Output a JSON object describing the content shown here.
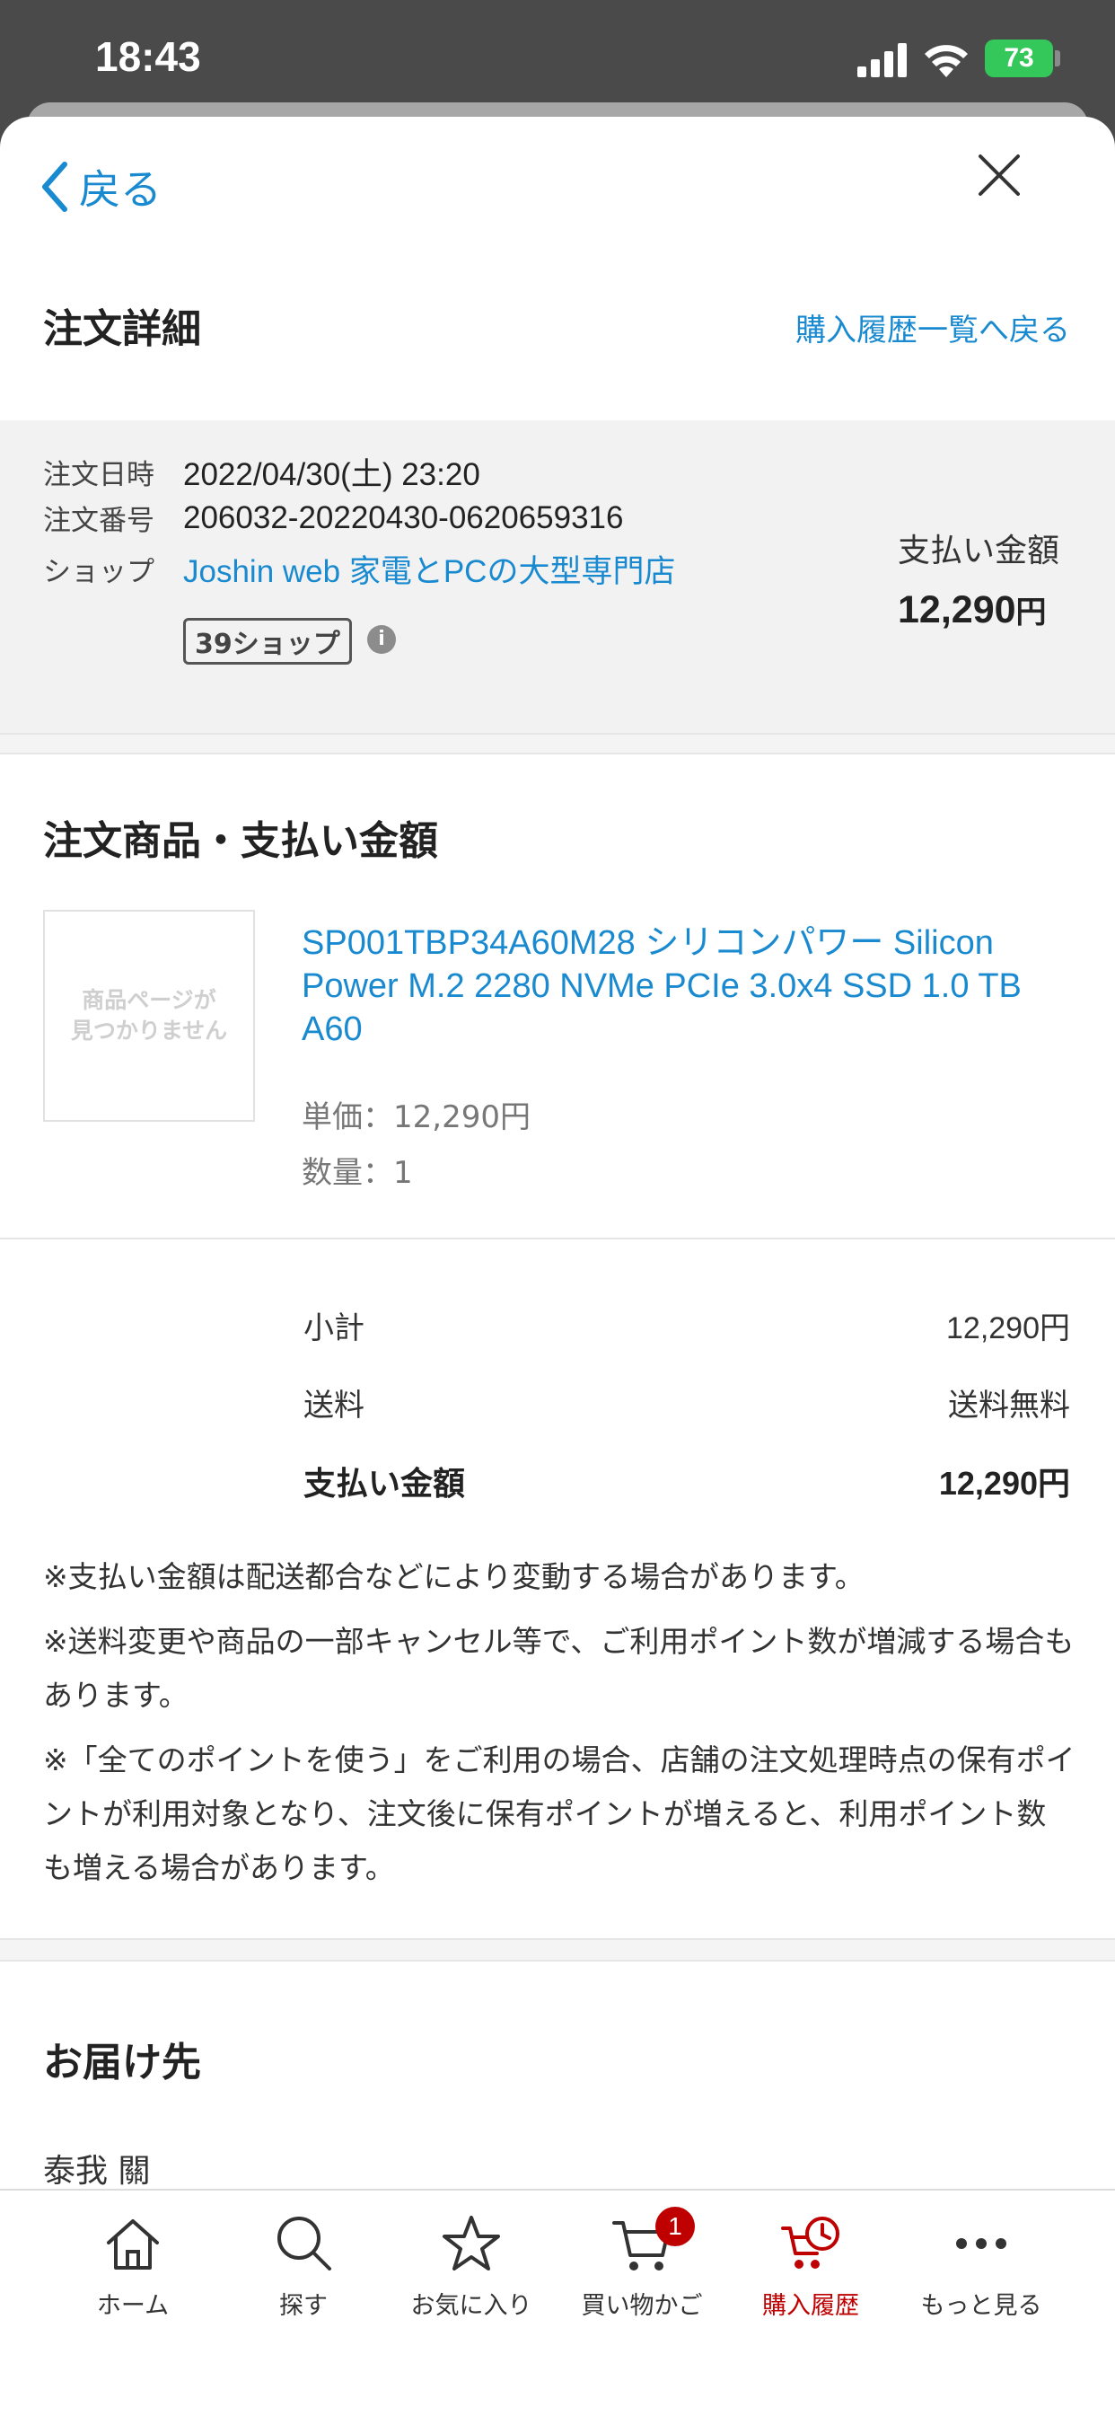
{
  "status_bar": {
    "time": "18:43",
    "battery": "73"
  },
  "header": {
    "back_label": "戻る"
  },
  "page": {
    "title": "注文詳細",
    "history_link": "購入履歴一覧へ戻る"
  },
  "summary": {
    "date_label": "注文日時",
    "date_value": "2022/04/30(土) 23:20",
    "number_label": "注文番号",
    "number_value": "206032-20220430-0620659316",
    "shop_label": "ショップ",
    "shop_name": "Joshin web 家電とPCの大型専門店",
    "shop_badge": "39ショップ",
    "pay_label": "支払い金額",
    "pay_amount": "12,290",
    "pay_unit": "円"
  },
  "items_section": {
    "title": "注文商品・支払い金額",
    "image_placeholder_line1": "商品ページが",
    "image_placeholder_line2": "見つかりません",
    "product_name": "SP001TBP34A60M28 シリコンパワー Silicon Power M.2 2280 NVMe PCIe 3.0x4 SSD 1.0 TB A60",
    "unit_price": "単価：12,290円",
    "quantity": "数量：1"
  },
  "totals": [
    {
      "label": "小計",
      "value": "12,290円"
    },
    {
      "label": "送料",
      "value": "送料無料"
    },
    {
      "label": "支払い金額",
      "value": "12,290円"
    }
  ],
  "notes": [
    "※支払い金額は配送都合などにより変動する場合があります。",
    "※送料変更や商品の一部キャンセル等で、ご利用ポイント数が増減する場合もあります。",
    "※「全てのポイントを使う」をご利用の場合、店舗の注文処理時点の保有ポイントが利用対象となり、注文後に保有ポイントが増えると、利用ポイント数も増える場合があります。"
  ],
  "delivery": {
    "title": "お届け先",
    "recipient": "泰我 關"
  },
  "tabbar": {
    "tabs": [
      {
        "label": "ホーム",
        "icon": "home-icon"
      },
      {
        "label": "探す",
        "icon": "search-icon"
      },
      {
        "label": "お気に入り",
        "icon": "star-icon"
      },
      {
        "label": "買い物かご",
        "icon": "cart-icon",
        "badge": "1"
      },
      {
        "label": "購入履歴",
        "icon": "purchase-history-icon",
        "active": true
      },
      {
        "label": "もっと見る",
        "icon": "more-icon"
      }
    ],
    "accent_color": "#bf0000"
  },
  "colors": {
    "link": "#1a8ad0",
    "active_tab": "#bf0000",
    "battery": "#34c759"
  }
}
